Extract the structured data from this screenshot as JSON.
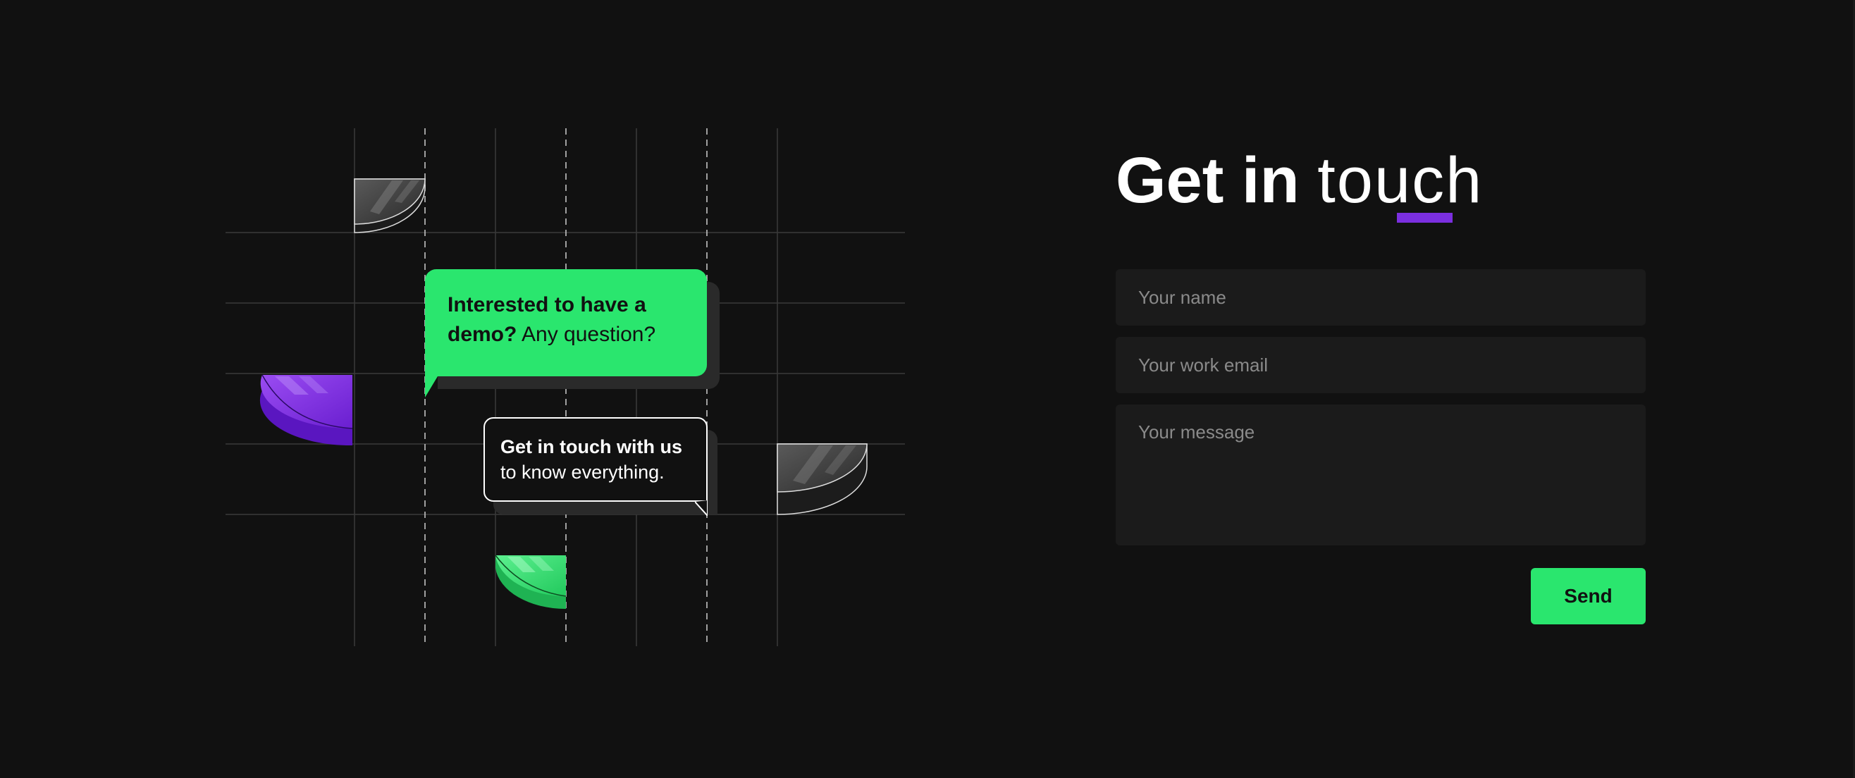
{
  "colors": {
    "background": "#111111",
    "accent_green": "#2ae66e",
    "accent_purple": "#7b2fe0",
    "field_background": "#1b1b1b"
  },
  "illustration": {
    "bubble_demo": {
      "bold_text": "Interested to have a demo?",
      "text": " Any question?"
    },
    "bubble_touch": {
      "bold_text": "Get in touch with us",
      "text": "to know everything."
    }
  },
  "contact": {
    "title_bold": "Get in",
    "title_light": "touch",
    "name_placeholder": "Your name",
    "email_placeholder": "Your work email",
    "message_placeholder": "Your message",
    "send_label": "Send"
  }
}
